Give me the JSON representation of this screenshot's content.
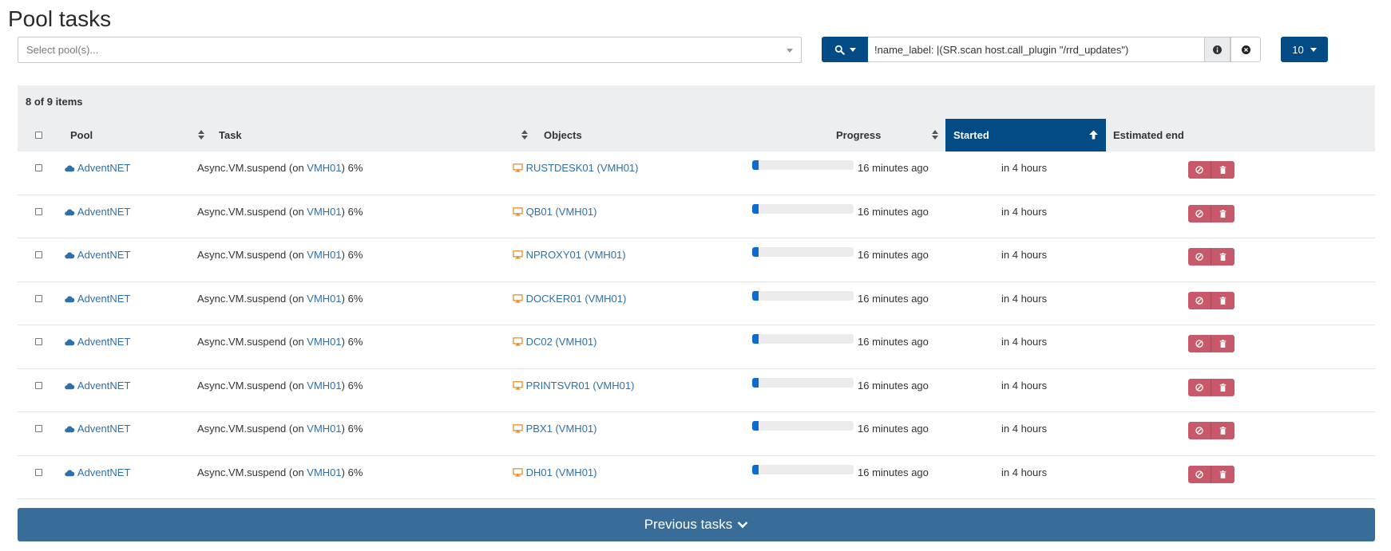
{
  "page": {
    "title": "Pool tasks"
  },
  "pool_select": {
    "placeholder": "Select pool(s)..."
  },
  "search": {
    "value": "!name_label: |(SR.scan host.call_plugin \"/rrd_updates\")"
  },
  "per_page": {
    "value": "10"
  },
  "table": {
    "count_label": "8 of 9 items",
    "columns": {
      "pool": "Pool",
      "task": "Task",
      "objects": "Objects",
      "progress": "Progress",
      "started": "Started",
      "estimated_end": "Estimated end"
    },
    "rows": [
      {
        "pool": "AdventNET",
        "task_prefix": "Async.VM.suspend (on ",
        "host": "VMH01",
        "task_suffix": ") 6%",
        "object": "RUSTDESK01 (VMH01)",
        "progress": 0.06,
        "started": "16 minutes ago",
        "estimated_end": "in 4 hours"
      },
      {
        "pool": "AdventNET",
        "task_prefix": "Async.VM.suspend (on ",
        "host": "VMH01",
        "task_suffix": ") 6%",
        "object": "QB01 (VMH01)",
        "progress": 0.06,
        "started": "16 minutes ago",
        "estimated_end": "in 4 hours"
      },
      {
        "pool": "AdventNET",
        "task_prefix": "Async.VM.suspend (on ",
        "host": "VMH01",
        "task_suffix": ") 6%",
        "object": "NPROXY01 (VMH01)",
        "progress": 0.06,
        "started": "16 minutes ago",
        "estimated_end": "in 4 hours"
      },
      {
        "pool": "AdventNET",
        "task_prefix": "Async.VM.suspend (on ",
        "host": "VMH01",
        "task_suffix": ") 6%",
        "object": "DOCKER01 (VMH01)",
        "progress": 0.06,
        "started": "16 minutes ago",
        "estimated_end": "in 4 hours"
      },
      {
        "pool": "AdventNET",
        "task_prefix": "Async.VM.suspend (on ",
        "host": "VMH01",
        "task_suffix": ") 6%",
        "object": "DC02 (VMH01)",
        "progress": 0.06,
        "started": "16 minutes ago",
        "estimated_end": "in 4 hours"
      },
      {
        "pool": "AdventNET",
        "task_prefix": "Async.VM.suspend (on ",
        "host": "VMH01",
        "task_suffix": ") 6%",
        "object": "PRINTSVR01 (VMH01)",
        "progress": 0.06,
        "started": "16 minutes ago",
        "estimated_end": "in 4 hours"
      },
      {
        "pool": "AdventNET",
        "task_prefix": "Async.VM.suspend (on ",
        "host": "VMH01",
        "task_suffix": ") 6%",
        "object": "PBX1 (VMH01)",
        "progress": 0.06,
        "started": "16 minutes ago",
        "estimated_end": "in 4 hours"
      },
      {
        "pool": "AdventNET",
        "task_prefix": "Async.VM.suspend (on ",
        "host": "VMH01",
        "task_suffix": ") 6%",
        "object": "DH01 (VMH01)",
        "progress": 0.06,
        "started": "16 minutes ago",
        "estimated_end": "in 4 hours"
      }
    ]
  },
  "footer": {
    "previous_tasks_label": "Previous tasks"
  },
  "icons": {
    "pool": "cloud-icon",
    "object": "desktop-icon",
    "cancel": "ban-icon",
    "delete": "trash-icon",
    "search": "search-icon",
    "info": "info-icon",
    "clear": "close-circle-icon",
    "expand": "chevron-down-icon",
    "sort": "sort-icon",
    "sort_up": "arrow-up-icon"
  },
  "colors": {
    "primary": "#034b85",
    "link": "#2f6fa7",
    "vm_icon": "#e48b25",
    "danger": "#c7596a",
    "progress": "#0c6bd1",
    "footer_button": "#376d98"
  }
}
